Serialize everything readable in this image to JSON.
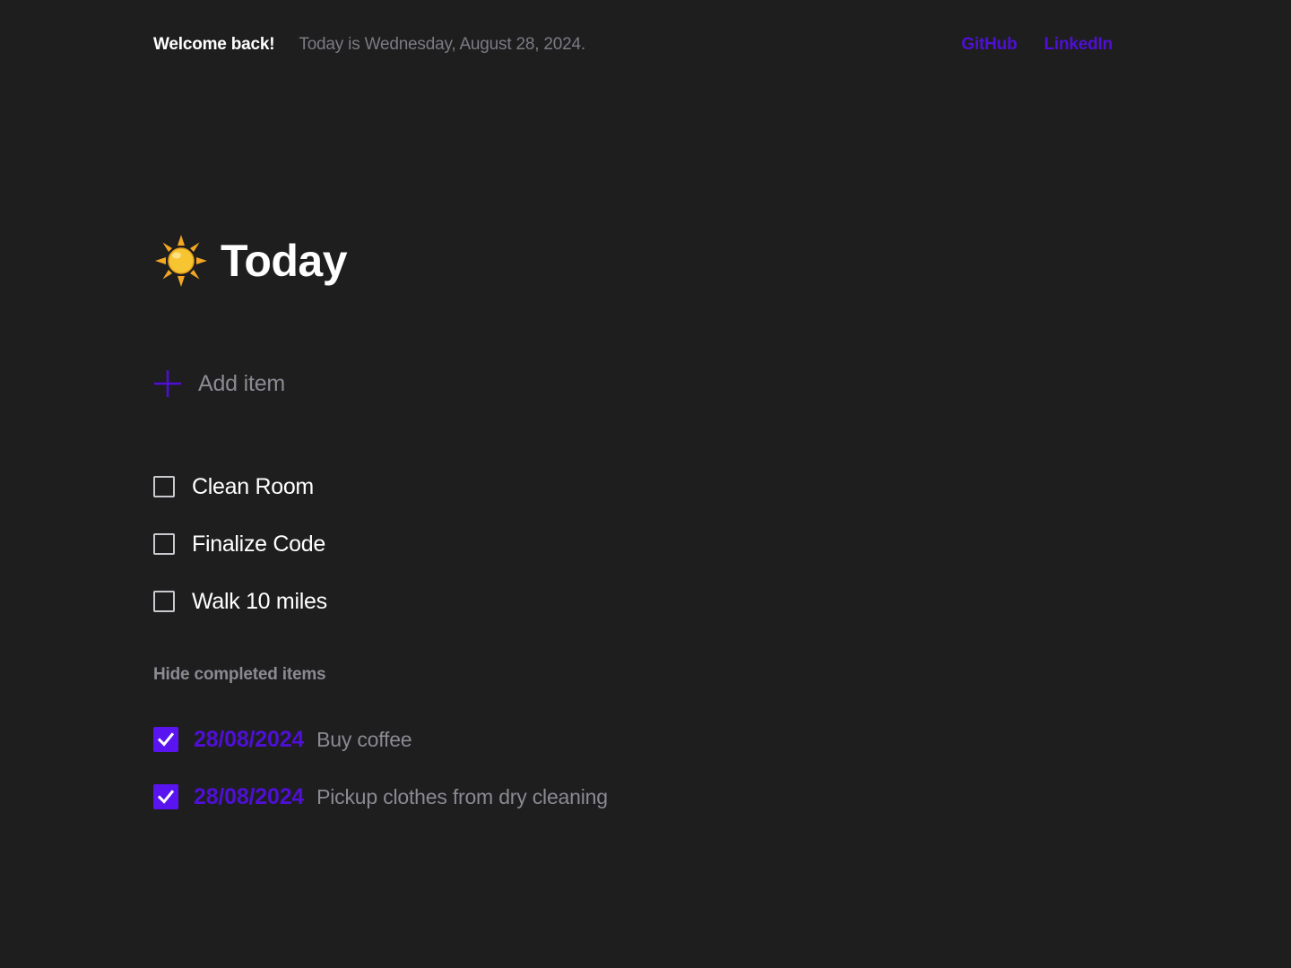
{
  "header": {
    "welcome": "Welcome back!",
    "date_text": "Today is Wednesday, August 28, 2024.",
    "links": {
      "github": "GitHub",
      "linkedin": "LinkedIn"
    }
  },
  "main": {
    "icon": "sun-icon",
    "title": "Today",
    "add_item_label": "Add item",
    "todos": [
      {
        "label": "Clean Room",
        "checked": false
      },
      {
        "label": "Finalize Code",
        "checked": false
      },
      {
        "label": "Walk 10 miles",
        "checked": false
      }
    ],
    "hide_completed_label": "Hide completed items",
    "completed": [
      {
        "date": "28/08/2024",
        "label": "Buy coffee",
        "checked": true
      },
      {
        "date": "28/08/2024",
        "label": "Pickup clothes from dry cleaning",
        "checked": true
      }
    ]
  },
  "colors": {
    "background": "#1e1e1f",
    "accent": "#4f0fd6",
    "checkbox_fill": "#5a14f0",
    "muted_text": "#8a8a92",
    "sun": "#f5b82e"
  }
}
